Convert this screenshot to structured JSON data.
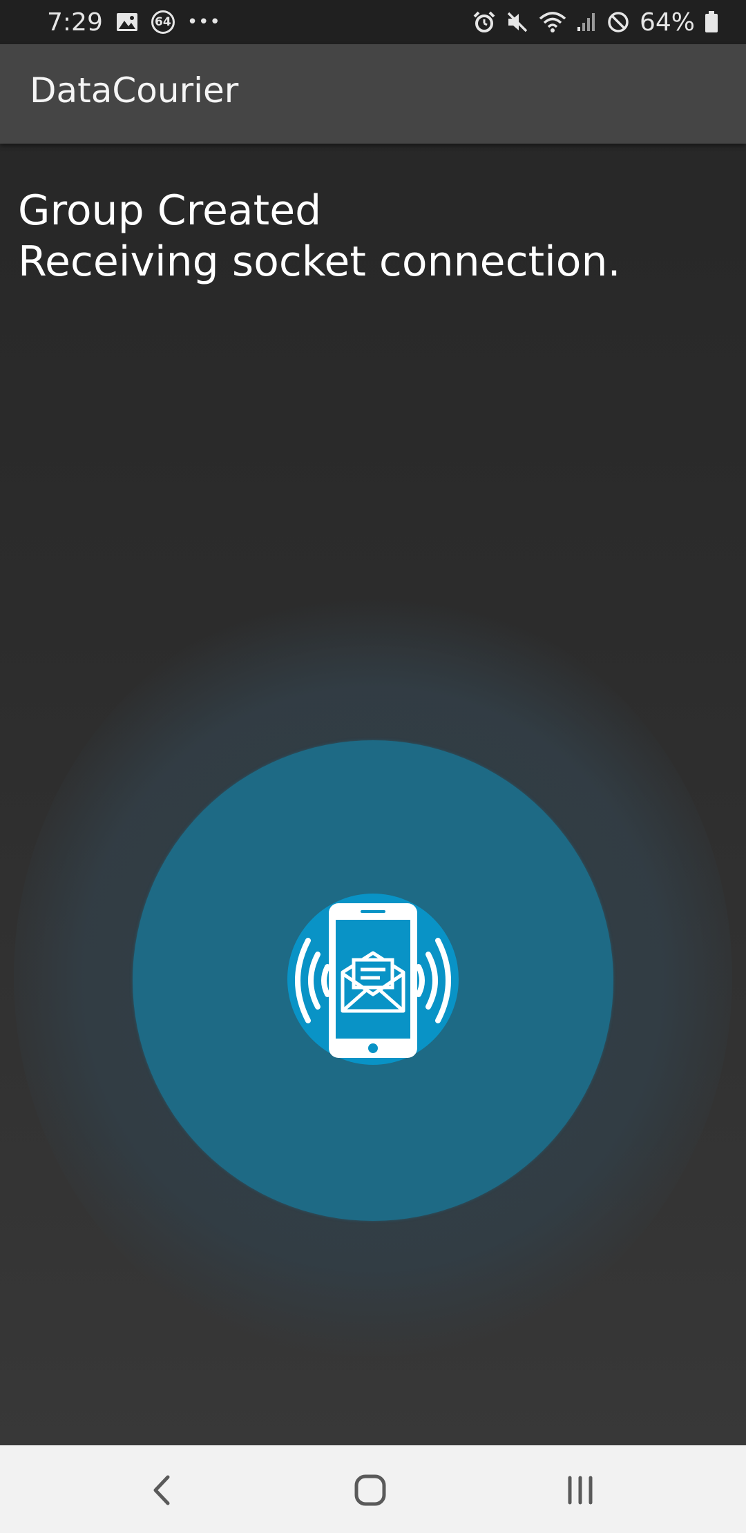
{
  "status_bar": {
    "time": "7:29",
    "notification_count": "64",
    "overflow_dots": "•••",
    "battery_percent": "64%",
    "icons": [
      "gallery-icon",
      "alarm-icon",
      "mute-icon",
      "wifi-icon",
      "signal-icon",
      "do-not-disturb-icon",
      "battery-icon"
    ]
  },
  "app_bar": {
    "title": "DataCourier"
  },
  "status_message": {
    "line1": "Group Created",
    "line2": "Receiving socket connection."
  },
  "center_icon": {
    "name": "phone-receiving-mail-icon",
    "accent_color": "#0993c6",
    "pulse_color": "#1e6a85"
  },
  "nav_bar": {
    "buttons": [
      "back",
      "home",
      "recent-apps"
    ]
  }
}
